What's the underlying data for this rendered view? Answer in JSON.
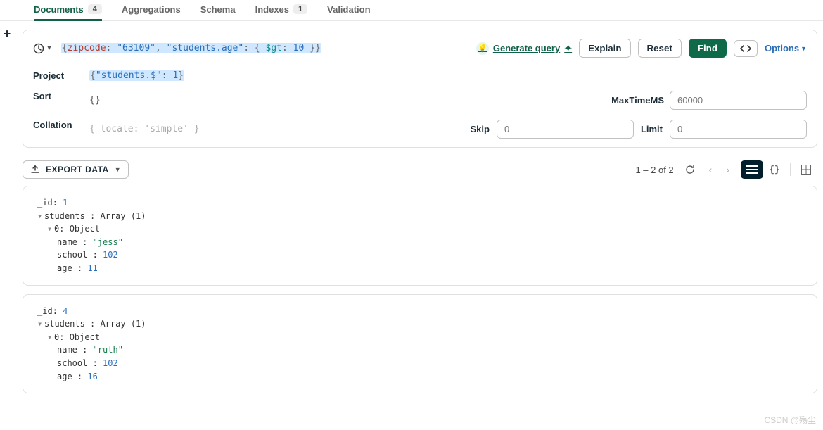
{
  "tabs": {
    "documents": {
      "label": "Documents",
      "badge": "4"
    },
    "aggregations": {
      "label": "Aggregations"
    },
    "schema": {
      "label": "Schema"
    },
    "indexes": {
      "label": "Indexes",
      "badge": "1"
    },
    "validation": {
      "label": "Validation"
    }
  },
  "filter": {
    "open": "{",
    "k1": "zipcode",
    "c1": ": ",
    "v1": "\"63109\"",
    "sep": ", ",
    "k2": "\"students.age\"",
    "c2": ": { ",
    "k3": "$gt",
    "c3": ": ",
    "v3": "10",
    "close": " }}"
  },
  "actions": {
    "generate": "Generate query",
    "explain": "Explain",
    "reset": "Reset",
    "find": "Find",
    "options": "Options"
  },
  "opts": {
    "project_label": "Project",
    "project_open": "{",
    "project_k": "\"students.$\"",
    "project_c": ": ",
    "project_v": "1",
    "project_close": "}",
    "sort_label": "Sort",
    "sort_val": "{}",
    "collation_label": "Collation",
    "collation_val": "{ locale: 'simple' }",
    "maxtime_label": "MaxTimeMS",
    "maxtime_ph": "60000",
    "skip_label": "Skip",
    "skip_ph": "0",
    "limit_label": "Limit",
    "limit_ph": "0"
  },
  "toolbar": {
    "export": "EXPORT DATA",
    "count": "1 – 2 of 2"
  },
  "docs": [
    {
      "id_key": "_id",
      "id_val": "1",
      "students_key": "students",
      "students_type": "Array (1)",
      "idx_key": "0",
      "idx_type": "Object",
      "name_key": "name",
      "name_val": "\"jess\"",
      "school_key": "school",
      "school_val": "102",
      "age_key": "age",
      "age_val": "11"
    },
    {
      "id_key": "_id",
      "id_val": "4",
      "students_key": "students",
      "students_type": "Array (1)",
      "idx_key": "0",
      "idx_type": "Object",
      "name_key": "name",
      "name_val": "\"ruth\"",
      "school_key": "school",
      "school_val": "102",
      "age_key": "age",
      "age_val": "16"
    }
  ],
  "watermark": "CSDN @殇尘"
}
